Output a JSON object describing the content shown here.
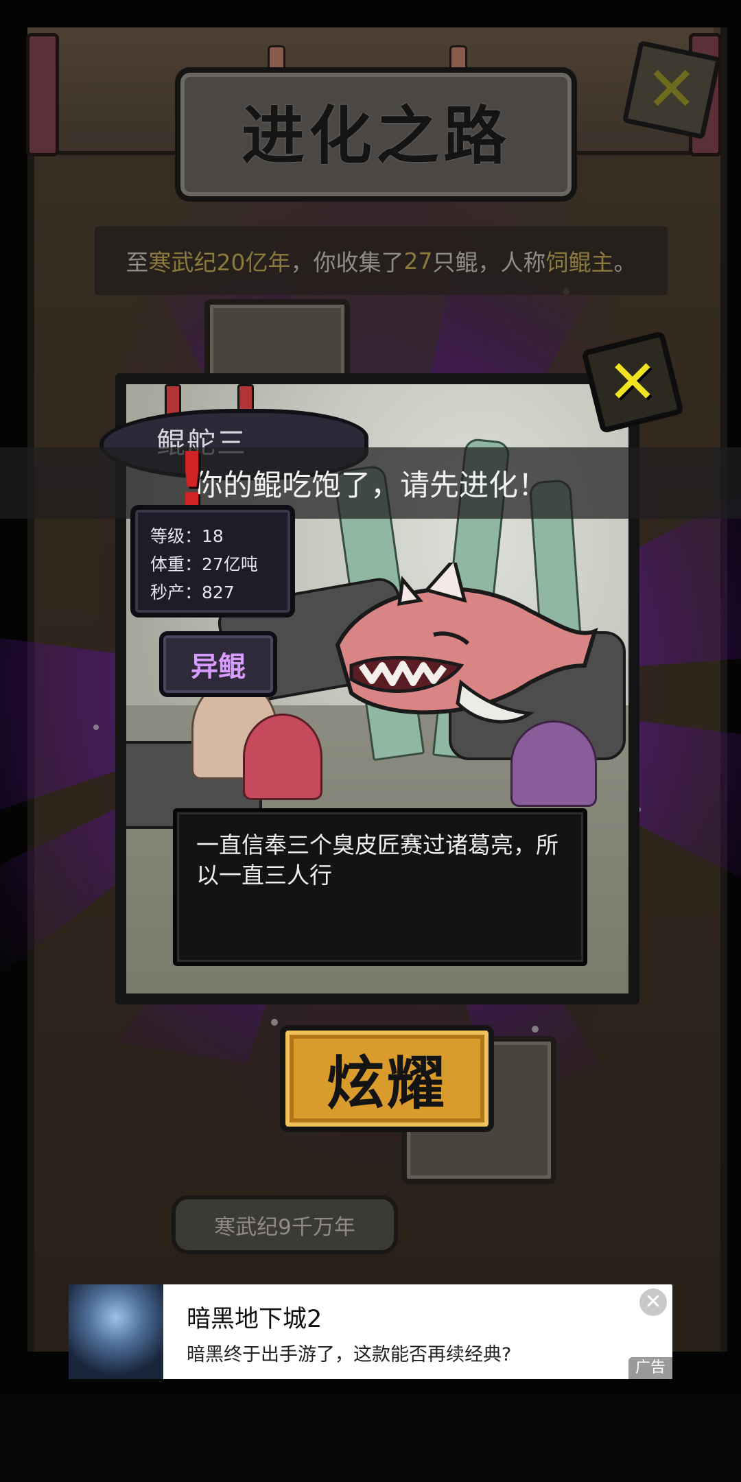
{
  "screen": {
    "title": "进化之路",
    "summary": {
      "prefix": "至",
      "era": "寒武纪20亿年",
      "middle": "，你收集了",
      "count": "27",
      "middle2": "只鲲，人称",
      "nickname": "饲鲲主",
      "suffix": "。"
    },
    "era_badge": "寒武纪9千万年",
    "close_icon": "close-x-icon"
  },
  "toast": {
    "message": "你的鲲吃饱了，请先进化！"
  },
  "card": {
    "name": "鲲舵三",
    "stats": [
      {
        "label": "等级：",
        "value": "18"
      },
      {
        "label": "体重：",
        "value": "27亿吨"
      },
      {
        "label": "秒产：",
        "value": "827"
      }
    ],
    "type_tag": "异鲲",
    "description": "一直信奉三个臭皮匠赛过诸葛亮，所以一直三人行",
    "share_button": "炫耀",
    "close_icon": "close-x-icon"
  },
  "ad": {
    "title": "暗黑地下城2",
    "subtitle": "暗黑终于出手游了，这款能否再续经典?",
    "tag": "广告",
    "close_glyph": "✕"
  },
  "colors": {
    "accent_purple": "#8a2be2",
    "button_gold": "#d99b2c",
    "close_yellow": "#f1e322",
    "warning_red": "#d22424"
  }
}
